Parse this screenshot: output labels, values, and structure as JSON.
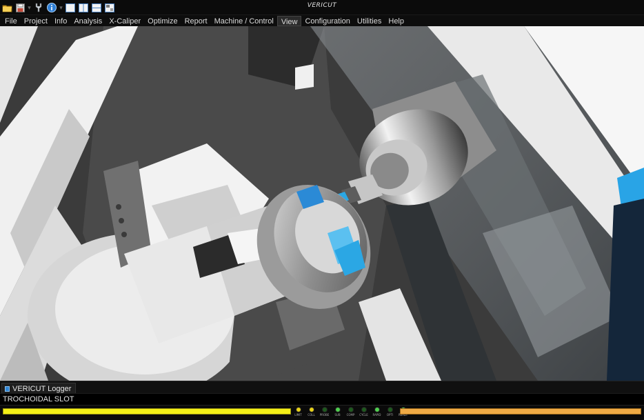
{
  "window": {
    "title": "VERICUT"
  },
  "quick_access": [
    {
      "icon": "open-folder-icon"
    },
    {
      "icon": "save-icon"
    },
    {
      "icon": "tool-icon"
    },
    {
      "icon": "info-icon"
    },
    {
      "icon": "single-view-icon"
    },
    {
      "icon": "split-view-vertical-icon"
    },
    {
      "icon": "split-view-horizontal-icon"
    },
    {
      "icon": "layout-icon"
    }
  ],
  "menu": [
    {
      "label": "File"
    },
    {
      "label": "Project"
    },
    {
      "label": "Info"
    },
    {
      "label": "Analysis"
    },
    {
      "label": "X-Caliper"
    },
    {
      "label": "Optimize"
    },
    {
      "label": "Report"
    },
    {
      "label": "Machine / Control"
    },
    {
      "label": "View",
      "active": true
    },
    {
      "label": "Configuration"
    },
    {
      "label": "Utilities"
    },
    {
      "label": "Help"
    }
  ],
  "logger": {
    "tab_label": "VERICUT Logger",
    "message": "TROCHOIDAL SLOT"
  },
  "status": {
    "progress_color": "#f3ef17",
    "secondary_color": "#efaa45",
    "leds": [
      {
        "label": "LIMIT",
        "color": "#e8d21a"
      },
      {
        "label": "COLL",
        "color": "#e8d21a"
      },
      {
        "label": "PROBE",
        "color": "#1e5a1e"
      },
      {
        "label": "SUB",
        "color": "#4fd04f"
      },
      {
        "label": "COMP",
        "color": "#1e5a1e"
      },
      {
        "label": "CYCLE",
        "color": "#1e5a1e"
      },
      {
        "label": "RAPID",
        "color": "#4fd04f"
      },
      {
        "label": "OPTI",
        "color": "#1e5a1e"
      },
      {
        "label": "READY",
        "color": "#4fd04f"
      }
    ]
  }
}
